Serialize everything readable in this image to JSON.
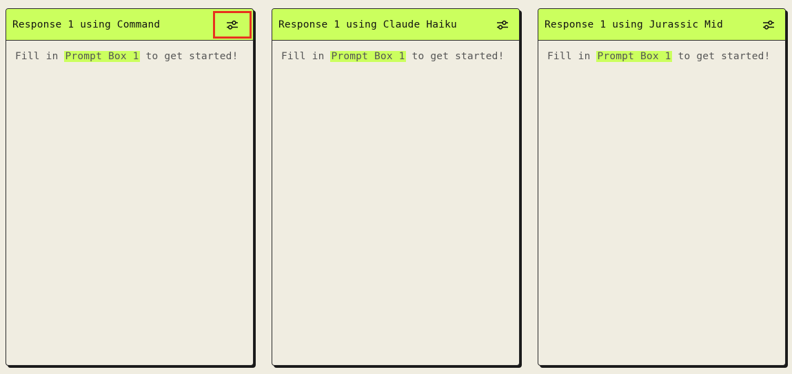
{
  "panels": [
    {
      "title": "Response 1 using Command",
      "body_prefix": "Fill in ",
      "body_link": "Prompt Box 1",
      "body_suffix": " to get started!",
      "settings_icon": "sliders-icon",
      "settings_highlighted": true
    },
    {
      "title": "Response 1 using Claude Haiku",
      "body_prefix": "Fill in ",
      "body_link": "Prompt Box 1",
      "body_suffix": " to get started!",
      "settings_icon": "sliders-icon",
      "settings_highlighted": false
    },
    {
      "title": "Response 1 using Jurassic Mid",
      "body_prefix": "Fill in ",
      "body_link": "Prompt Box 1",
      "body_suffix": " to get started!",
      "settings_icon": "sliders-icon",
      "settings_highlighted": false
    }
  ],
  "colors": {
    "background": "#f0ede1",
    "accent": "#cbff5e",
    "highlight_box": "#e8321e",
    "border": "#2a2a2a"
  }
}
